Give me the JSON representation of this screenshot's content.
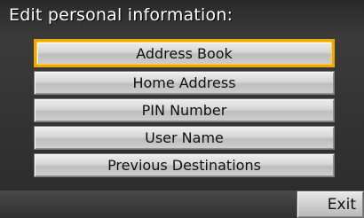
{
  "screen": {
    "title": "Edit personal information:"
  },
  "menu": {
    "items": [
      {
        "label": "Address Book",
        "selected": true
      },
      {
        "label": "Home Address"
      },
      {
        "label": "PIN Number"
      },
      {
        "label": "User Name"
      },
      {
        "label": "Previous Destinations"
      }
    ]
  },
  "footer": {
    "exit_label": "Exit"
  },
  "colors": {
    "selection_outline": "#f0a800",
    "button_face": "#d6d6d6",
    "background": "#333333",
    "title_text": "#ffffff"
  }
}
